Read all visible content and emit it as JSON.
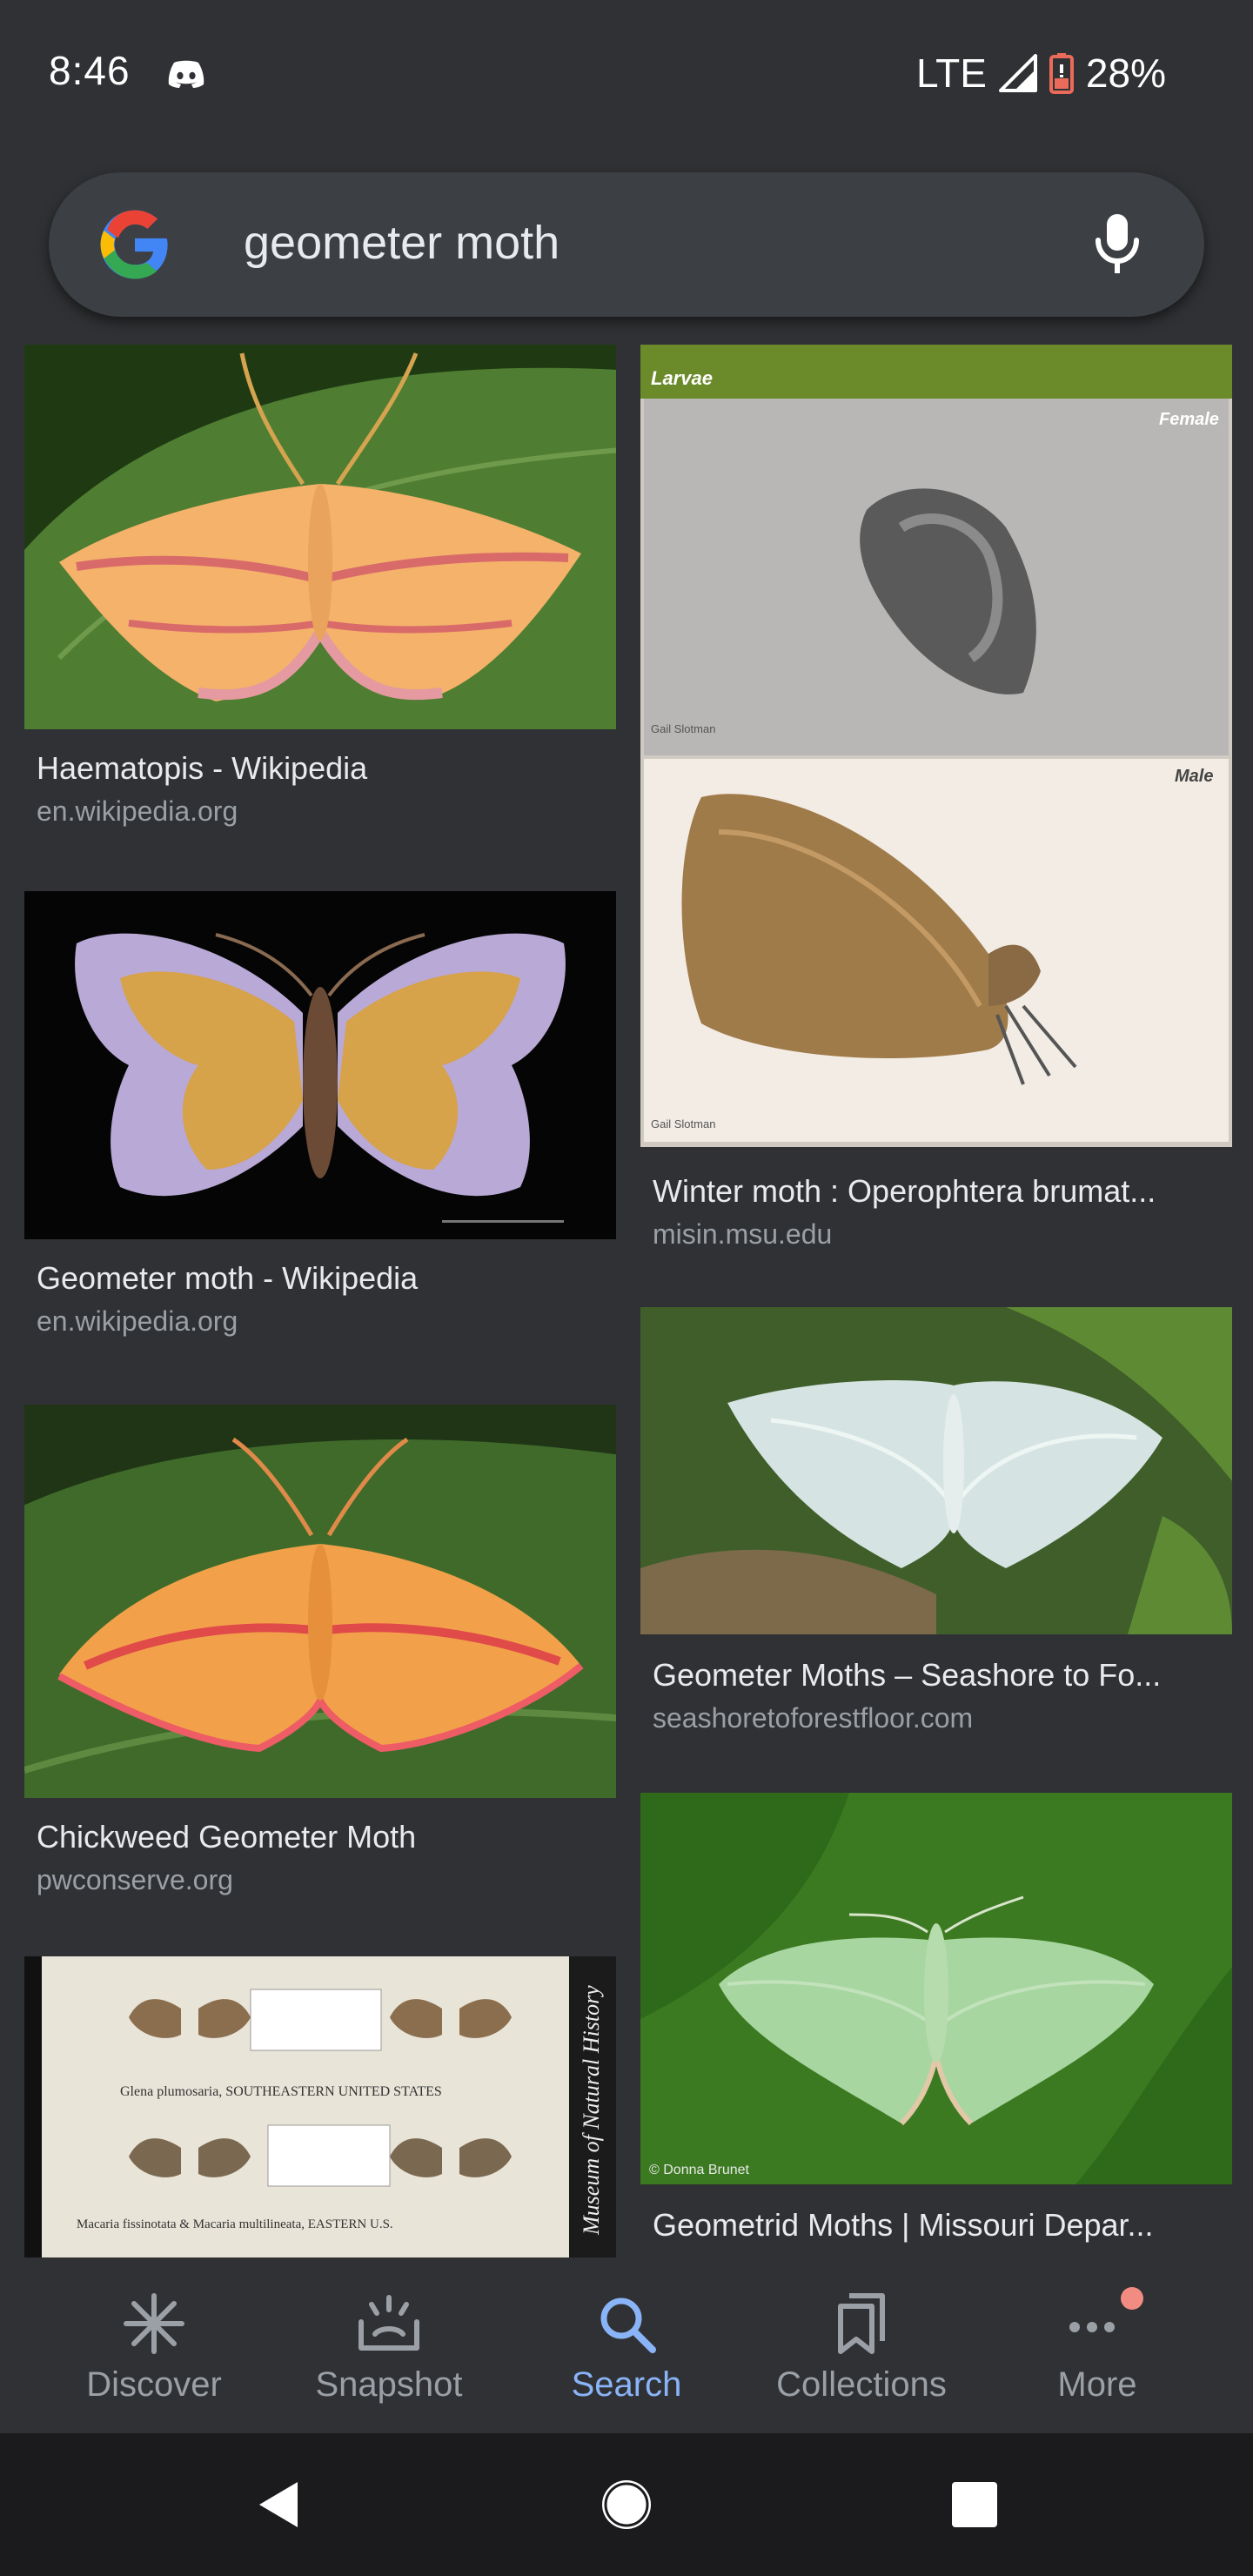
{
  "status_bar": {
    "time": "8:46",
    "network": "LTE",
    "battery": "28%",
    "icons": [
      "discord-icon",
      "signal-icon",
      "battery-icon"
    ]
  },
  "search": {
    "query": "geometer moth",
    "icons": [
      "google-logo",
      "mic-icon"
    ]
  },
  "results": {
    "left_column": [
      {
        "title": "Haematopis - Wikipedia",
        "source": "en.wikipedia.org"
      },
      {
        "title": "Geometer moth - Wikipedia",
        "source": "en.wikipedia.org"
      },
      {
        "title": "Chickweed Geometer Moth",
        "source": "pwconserve.org"
      },
      {
        "title": "",
        "source": ""
      }
    ],
    "right_column": [
      {
        "title": "Winter moth : Operophtera brumat...",
        "source": "misin.msu.edu"
      },
      {
        "title": "Geometer Moths – Seashore to Fo...",
        "source": "seashoretoforestfloor.com"
      },
      {
        "title": "Geometrid Moths | Missouri Depar...",
        "source": ""
      }
    ],
    "image_texts": {
      "larvae": "Larvae",
      "female": "Female",
      "male": "Male",
      "credit_winter_1": "Gail Slotman",
      "credit_winter_2": "Gail Slotman",
      "credit_missouri": "© Donna Brunet",
      "museum_caption_1": "Glena plumosaria, SOUTHEASTERN UNITED STATES",
      "museum_caption_2": "Macaria fissinotata & Macaria multilineata, EASTERN U.S.",
      "museum_sidebar": "Museum of Natural History"
    }
  },
  "bottom_nav": {
    "items": [
      {
        "label": "Discover",
        "icon": "asterisk-icon"
      },
      {
        "label": "Snapshot",
        "icon": "snapshot-icon"
      },
      {
        "label": "Search",
        "icon": "search-icon"
      },
      {
        "label": "Collections",
        "icon": "collections-icon"
      },
      {
        "label": "More",
        "icon": "more-dots-icon"
      }
    ],
    "active": "Search",
    "colors": {
      "active": "#8ab4f8",
      "inactive": "#9aa0a6",
      "notification": "#f28b82"
    }
  },
  "system_nav": {
    "icons": [
      "back-icon",
      "home-icon",
      "recents-icon"
    ]
  }
}
